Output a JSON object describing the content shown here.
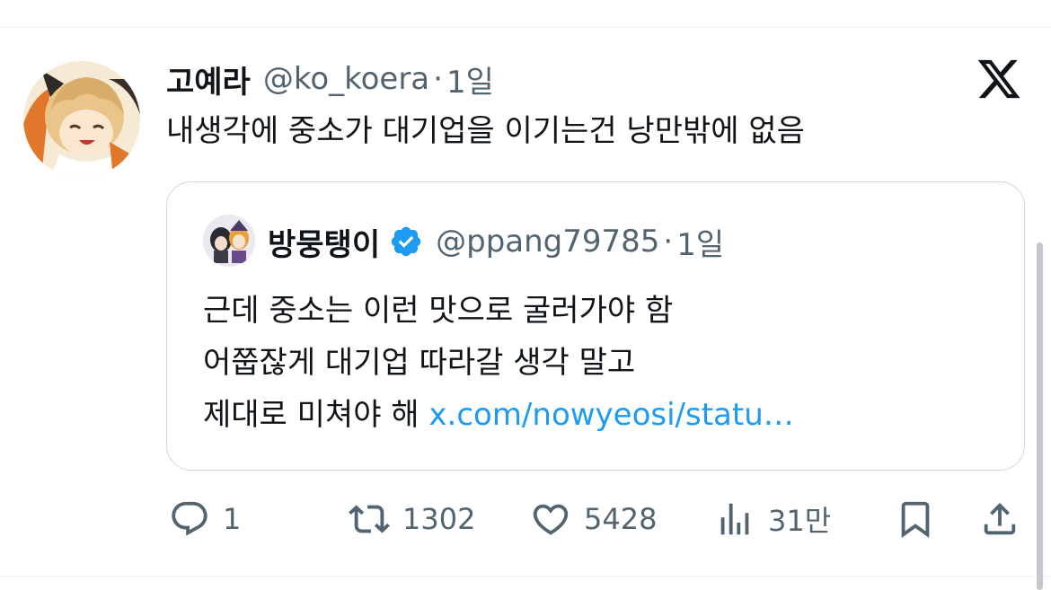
{
  "tweet": {
    "author_name": "고예라",
    "author_handle": "@ko_koera",
    "separator": "·",
    "time": "1일",
    "text": "내생각에 중소가 대기업을 이기는건 낭만밖에 없음"
  },
  "quote": {
    "author_name": "방뭉탱이",
    "author_handle": "@ppang79785",
    "separator": "·",
    "time": "1일",
    "line1": "근데 중소는 이런 맛으로 굴러가야 함",
    "line2": "어쭙잖게 대기업 따라갈 생각 말고",
    "line3_text": "제대로 미쳐야 해",
    "line3_link": "x.com/nowyeosi/statu…"
  },
  "actions": {
    "reply_count": "1",
    "retweet_count": "1302",
    "like_count": "5428",
    "views_count": "31만"
  },
  "colors": {
    "text": "#0f1419",
    "secondary": "#536471",
    "link": "#1d9bf0",
    "verified": "#1d9bf0",
    "border": "#cfd9de"
  }
}
